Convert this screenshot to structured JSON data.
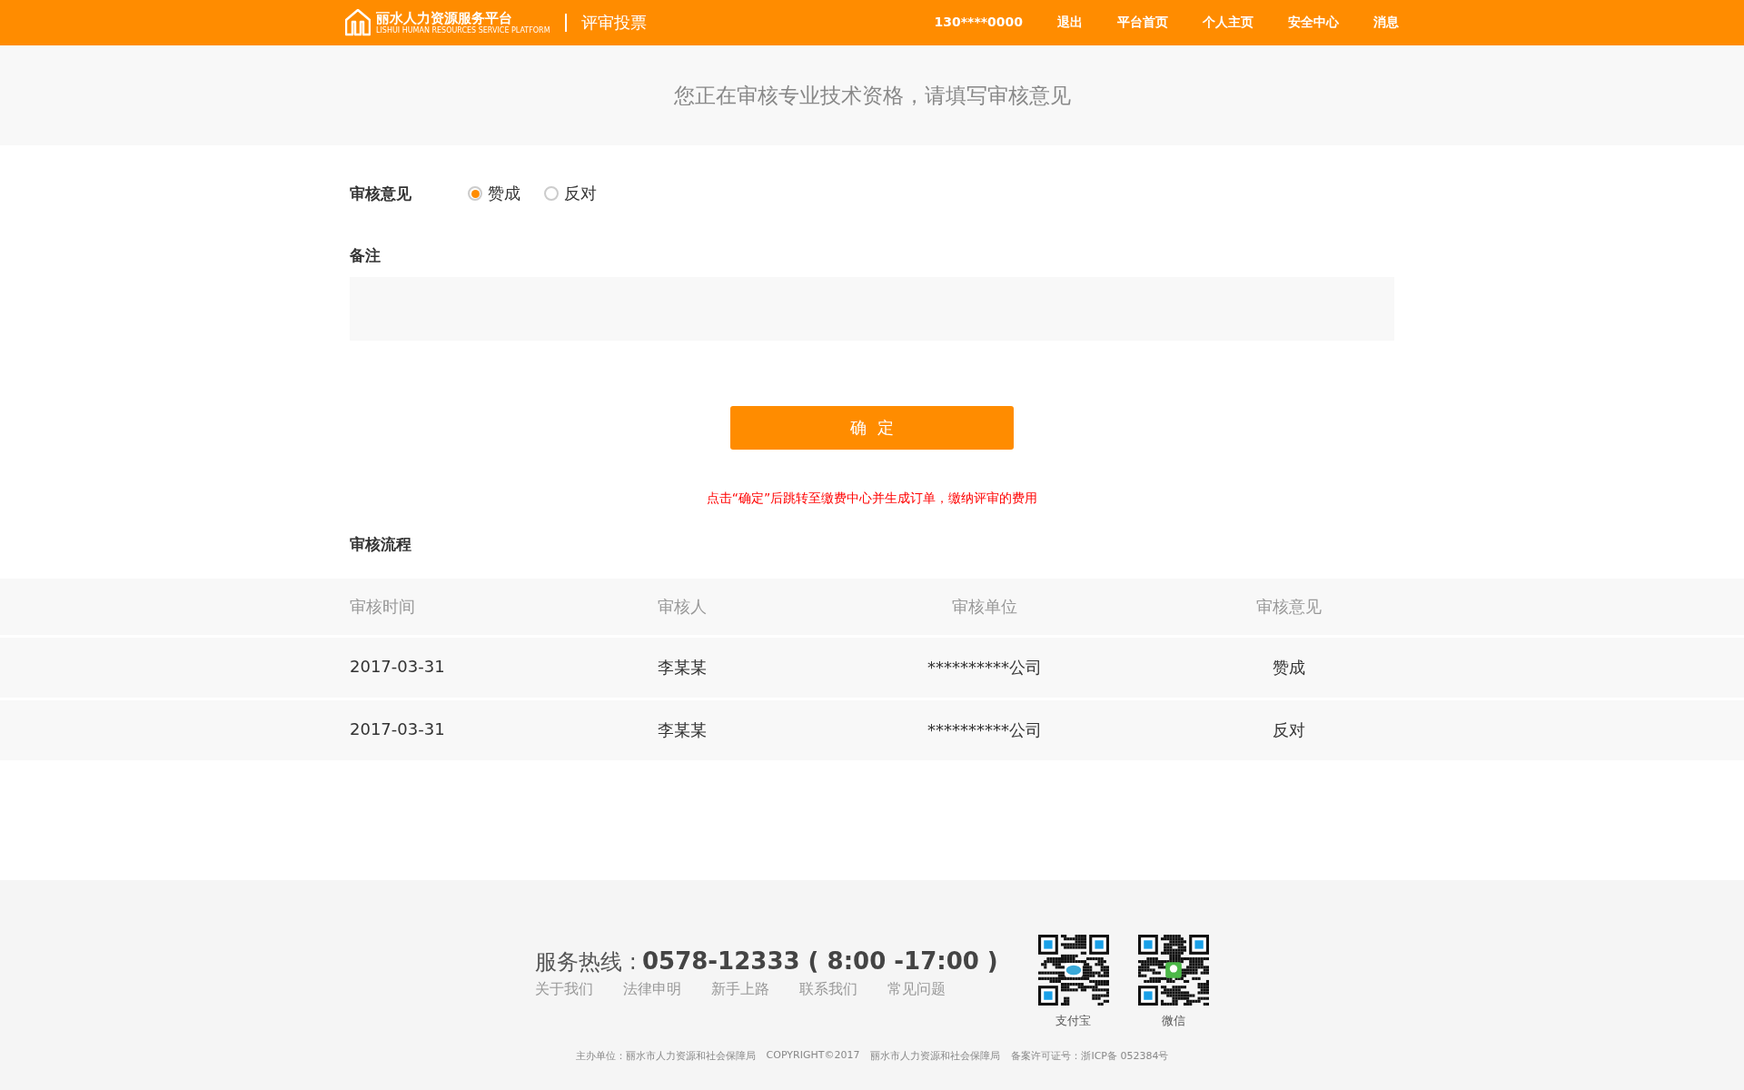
{
  "header": {
    "logo_title": "丽水人力资源服务平台",
    "logo_subtitle": "LISHUI HUMAN RESOURCES SERVICE PLATFORM",
    "section": "评审投票",
    "nav": [
      "130****0000",
      "退出",
      "平台首页",
      "个人主页",
      "安全中心",
      "消息"
    ]
  },
  "banner": {
    "title": "您正在审核专业技术资格，请填写审核意见"
  },
  "form": {
    "opinion_label": "审核意见",
    "options": [
      {
        "label": "赞成",
        "selected": true
      },
      {
        "label": "反对",
        "selected": false
      }
    ],
    "remark_label": "备注",
    "confirm_button": "确  定",
    "notice": "点击“确定”后跳转至缴费中心并生成订单，缴纳评审的费用"
  },
  "process": {
    "title": "审核流程",
    "columns": [
      "审核时间",
      "审核人",
      "审核单位",
      "审核意见"
    ],
    "rows": [
      [
        "2017-03-31",
        "李某某",
        "**********公司",
        "赞成"
      ],
      [
        "2017-03-31",
        "李某某",
        "**********公司",
        "反对"
      ]
    ]
  },
  "footer": {
    "hotline_label": "服务热线 :",
    "hotline_number": "0578-12333 ( 8:00 -17:00 )",
    "links": [
      "关于我们",
      "法律申明",
      "新手上路",
      "联系我们",
      "常见问题"
    ],
    "qr_codes": [
      {
        "label": "支付宝",
        "kind": "alipay"
      },
      {
        "label": "微信",
        "kind": "wechat"
      }
    ],
    "legal": [
      "主办单位：丽水市人力资源和社会保障局",
      "COPYRIGHT©2017",
      "丽水市人力资源和社会保障局",
      "备案许可证号：浙ICP备 052384号"
    ]
  }
}
